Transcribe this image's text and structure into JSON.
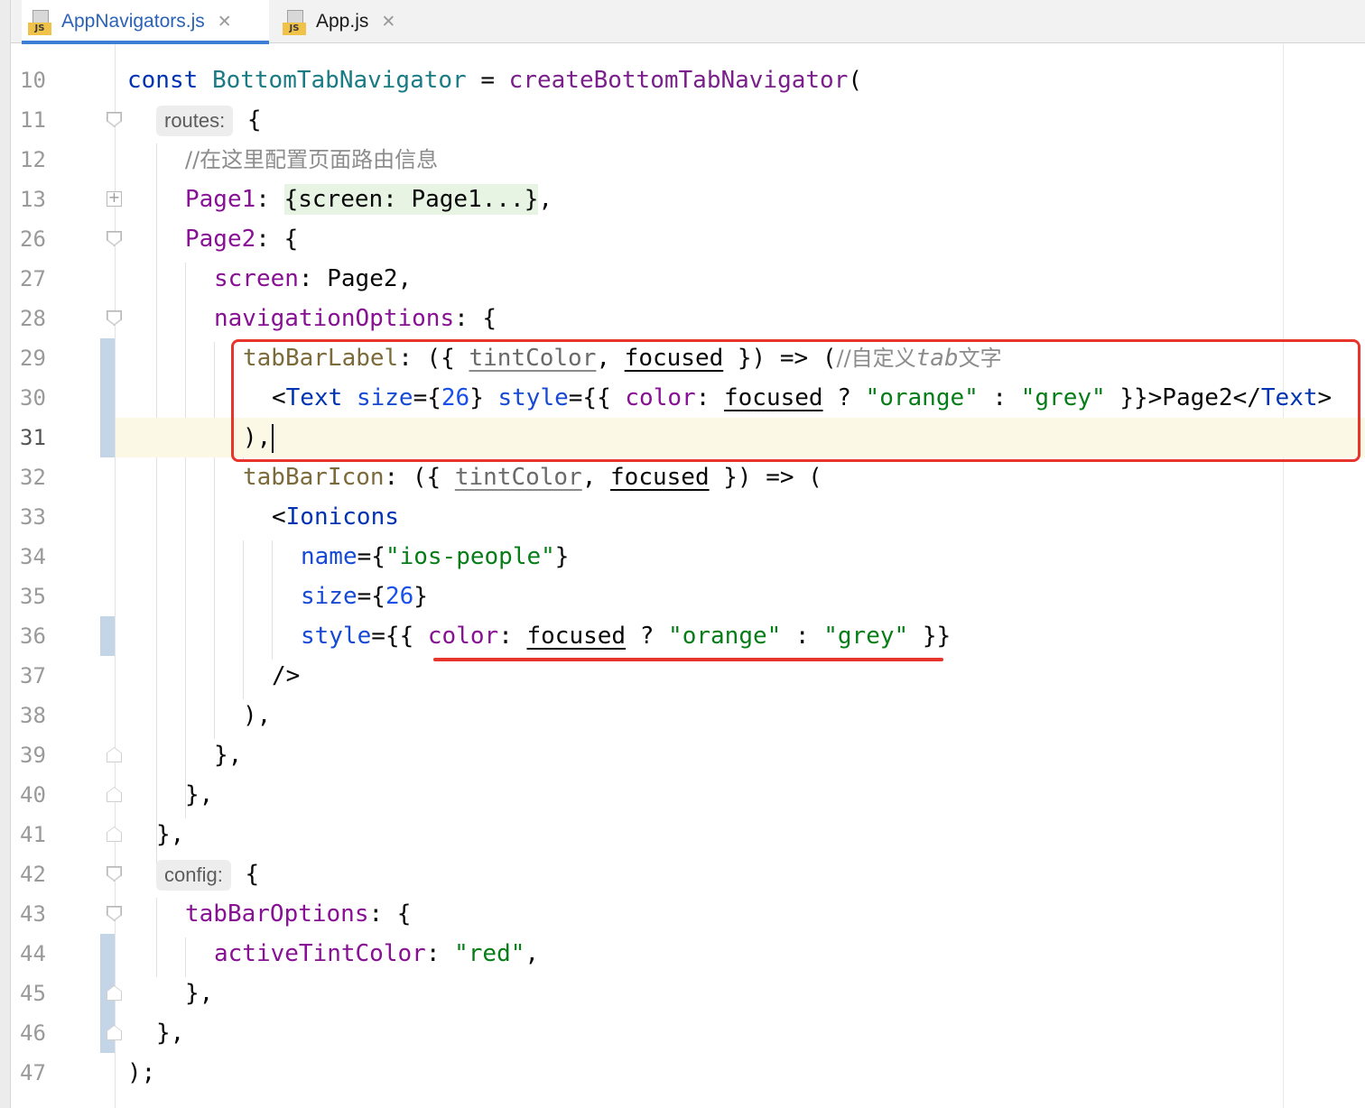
{
  "tabs": [
    {
      "label": "AppNavigators.js",
      "icon_badge": "JS",
      "active": true
    },
    {
      "label": "App.js",
      "icon_badge": "JS",
      "active": false
    }
  ],
  "lines": {
    "10": "10",
    "11": "11",
    "12": "12",
    "13": "13",
    "26": "26",
    "27": "27",
    "28": "28",
    "29": "29",
    "30": "30",
    "31": "31",
    "32": "32",
    "33": "33",
    "34": "34",
    "35": "35",
    "36": "36",
    "37": "37",
    "38": "38",
    "39": "39",
    "40": "40",
    "41": "41",
    "42": "42",
    "43": "43",
    "44": "44",
    "45": "45",
    "46": "46",
    "47": "47"
  },
  "code": {
    "l10": {
      "kw": "const",
      "cls": "BottomTabNavigator",
      "eq": " = ",
      "fn": "createBottomTabNavigator",
      "p": "("
    },
    "l11": {
      "hint": "routes:",
      "p": " {"
    },
    "l12": {
      "comment": "//在这里配置页面路由信息"
    },
    "l13": {
      "prop": "Page1",
      "colon": ": ",
      "folded": "{screen: Page1...}",
      "p": ","
    },
    "l26": {
      "prop": "Page2",
      "p": ": {"
    },
    "l27": {
      "prop": "screen",
      "colon": ": ",
      "val": "Page2",
      "p": ","
    },
    "l28": {
      "prop": "navigationOptions",
      "p": ": {"
    },
    "l29": {
      "param": "tabBarLabel",
      "a": ": ({ ",
      "p1": "tintColor",
      "sep": ", ",
      "p2": "focused",
      "b": " }) => (",
      "comment": "//自定义",
      "comment_it": "tab",
      "comment2": "文字"
    },
    "l30": {
      "lt": "<",
      "tag": "Text",
      "sp": " ",
      "attr1": "size",
      "eq1": "={",
      "num": "26",
      "c1": "} ",
      "attr2": "style",
      "eq2": "={{ ",
      "prop": "color",
      "colon": ": ",
      "p2": "focused",
      "q": " ? ",
      "s1": "\"orange\"",
      "or": " : ",
      "s2": "\"grey\"",
      "end": " }}>",
      "txt": "Page2",
      "close": "</",
      "tag2": "Text",
      "gt": ">"
    },
    "l31": {
      "p": "),"
    },
    "l32": {
      "param": "tabBarIcon",
      "a": ": ({ ",
      "p1": "tintColor",
      "sep": ", ",
      "p2": "focused",
      "b": " }) => ("
    },
    "l33": {
      "lt": "<",
      "tag": "Ionicons"
    },
    "l34": {
      "attr": "name",
      "eq": "={",
      "str": "\"ios-people\"",
      "c": "}"
    },
    "l35": {
      "attr": "size",
      "eq": "={",
      "num": "26",
      "c": "}"
    },
    "l36": {
      "attr": "style",
      "eq": "={{ ",
      "prop": "color",
      "colon": ": ",
      "p2": "focused",
      "q": " ? ",
      "s1": "\"orange\"",
      "or": " : ",
      "s2": "\"grey\"",
      "end": " }}"
    },
    "l37": {
      "p": "/>"
    },
    "l38": {
      "p": "),"
    },
    "l39": {
      "p": "},"
    },
    "l40": {
      "p": "},"
    },
    "l41": {
      "p": "},"
    },
    "l42": {
      "hint": "config:",
      "p": " {"
    },
    "l43": {
      "prop": "tabBarOptions",
      "p": ": {"
    },
    "l44": {
      "prop": "activeTintColor",
      "colon": ": ",
      "str": "\"red\"",
      "p": ","
    },
    "l45": {
      "p": "},"
    },
    "l46": {
      "p": "},"
    },
    "l47": {
      "p": ");"
    }
  },
  "colors": {
    "annotation": "#e8352b",
    "active_tab": "#3d7fd4",
    "current_line": "#fbf8e6"
  }
}
